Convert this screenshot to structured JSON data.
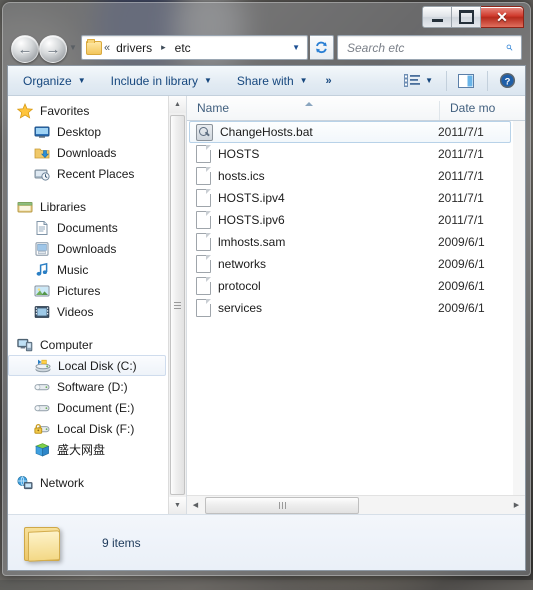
{
  "window": {
    "controls": {
      "minimize": "Minimize",
      "maximize": "Maximize",
      "close": "Close"
    }
  },
  "address_bar": {
    "back_label": "Back",
    "forward_label": "Forward",
    "history_label": "Recent pages",
    "folder_icon": "folder-icon",
    "overflow_chevron": "«",
    "crumbs": [
      "drivers",
      "etc"
    ],
    "separator": "▸",
    "dropdown": "▼",
    "refresh_label": "Refresh",
    "search_placeholder": "Search etc",
    "search_value": "",
    "search_icon": "search-icon"
  },
  "toolbar": {
    "organize": "Organize",
    "include_in_library": "Include in library",
    "share_with": "Share with",
    "overflow": "»",
    "caret": "▼",
    "views_icon": "list-view-icon",
    "preview_icon": "preview-pane-icon",
    "help_icon": "help-icon",
    "help_glyph": "?"
  },
  "nav_pane": {
    "groups": [
      {
        "header": {
          "label": "Favorites",
          "icon": "star-icon"
        },
        "items": [
          {
            "label": "Desktop",
            "icon": "desktop-icon"
          },
          {
            "label": "Downloads",
            "icon": "downloads-icon"
          },
          {
            "label": "Recent Places",
            "icon": "recent-places-icon"
          }
        ]
      },
      {
        "header": {
          "label": "Libraries",
          "icon": "libraries-icon"
        },
        "items": [
          {
            "label": "Documents",
            "icon": "documents-icon"
          },
          {
            "label": "Downloads",
            "icon": "downloads-library-icon"
          },
          {
            "label": "Music",
            "icon": "music-icon"
          },
          {
            "label": "Pictures",
            "icon": "pictures-icon"
          },
          {
            "label": "Videos",
            "icon": "videos-icon"
          }
        ]
      },
      {
        "header": {
          "label": "Computer",
          "icon": "computer-icon"
        },
        "items": [
          {
            "label": "Local Disk (C:)",
            "icon": "system-drive-icon",
            "selected": true
          },
          {
            "label": "Software (D:)",
            "icon": "drive-icon"
          },
          {
            "label": "Document (E:)",
            "icon": "drive-icon"
          },
          {
            "label": "Local Disk (F:)",
            "icon": "locked-drive-icon"
          },
          {
            "label": "盛大网盘",
            "icon": "network-disk-icon"
          }
        ]
      },
      {
        "header": {
          "label": "Network",
          "icon": "network-icon"
        },
        "items": []
      }
    ]
  },
  "file_list": {
    "columns": [
      {
        "key": "name",
        "label": "Name",
        "sorted": "ascending"
      },
      {
        "key": "date",
        "label": "Date mo"
      }
    ],
    "rows": [
      {
        "name": "ChangeHosts.bat",
        "date": "2011/7/1",
        "icon": "bat-file-icon",
        "selected": true
      },
      {
        "name": "HOSTS",
        "date": "2011/7/1",
        "icon": "generic-file-icon",
        "selected": false
      },
      {
        "name": "hosts.ics",
        "date": "2011/7/1",
        "icon": "generic-file-icon",
        "selected": false
      },
      {
        "name": "HOSTS.ipv4",
        "date": "2011/7/1",
        "icon": "generic-file-icon",
        "selected": false
      },
      {
        "name": "HOSTS.ipv6",
        "date": "2011/7/1",
        "icon": "generic-file-icon",
        "selected": false
      },
      {
        "name": "lmhosts.sam",
        "date": "2009/6/1",
        "icon": "generic-file-icon",
        "selected": false
      },
      {
        "name": "networks",
        "date": "2009/6/1",
        "icon": "generic-file-icon",
        "selected": false
      },
      {
        "name": "protocol",
        "date": "2009/6/1",
        "icon": "generic-file-icon",
        "selected": false
      },
      {
        "name": "services",
        "date": "2009/6/1",
        "icon": "generic-file-icon",
        "selected": false
      }
    ]
  },
  "status_bar": {
    "folder_icon": "folder-icon",
    "item_count": "9 items"
  },
  "colors": {
    "toolbar_text": "#16477e",
    "column_header_text": "#42607f",
    "selection_border": "#b8d2e8",
    "close_button": "#cf3a2c",
    "folder_yellow": "#f3c65c"
  }
}
